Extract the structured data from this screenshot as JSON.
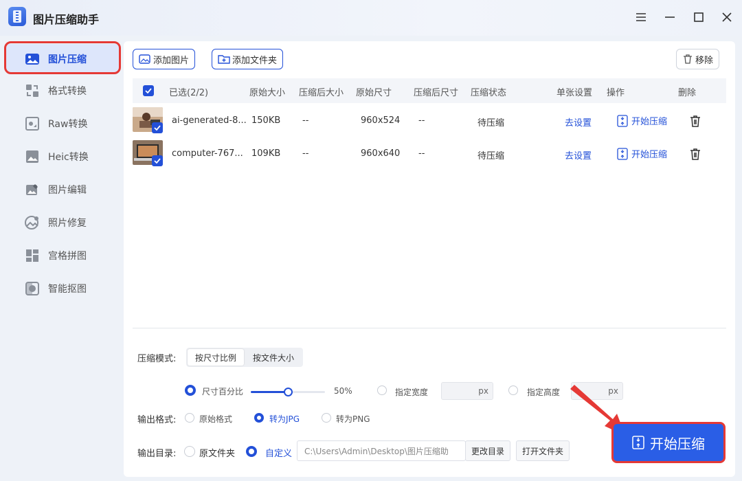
{
  "app": {
    "title": "图片压缩助手"
  },
  "sidebar": {
    "items": [
      {
        "label": "图片压缩",
        "icon": "image-compress-icon",
        "active": true
      },
      {
        "label": "格式转换",
        "icon": "format-convert-icon"
      },
      {
        "label": "Raw转换",
        "icon": "raw-convert-icon"
      },
      {
        "label": "Heic转换",
        "icon": "heic-convert-icon"
      },
      {
        "label": "图片编辑",
        "icon": "image-edit-icon"
      },
      {
        "label": "照片修复",
        "icon": "photo-repair-icon"
      },
      {
        "label": "宫格拼图",
        "icon": "grid-collage-icon"
      },
      {
        "label": "智能抠图",
        "icon": "smart-cutout-icon"
      }
    ]
  },
  "toolbar": {
    "add_image": "添加图片",
    "add_folder": "添加文件夹",
    "remove": "移除"
  },
  "table": {
    "headers": {
      "selected": "已选(2/2)",
      "orig_size": "原始大小",
      "compressed_size": "压缩后大小",
      "orig_dim": "原始尺寸",
      "compressed_dim": "压缩后尺寸",
      "status": "压缩状态",
      "single_setting": "单张设置",
      "action": "操作",
      "delete": "删除"
    },
    "rows": [
      {
        "name": "ai-generated-8...",
        "orig_size": "150KB",
        "compressed_size": "--",
        "orig_dim": "960x524",
        "compressed_dim": "--",
        "status": "待压缩",
        "setting": "去设置",
        "action": "开始压缩"
      },
      {
        "name": "computer-767...",
        "orig_size": "109KB",
        "compressed_size": "--",
        "orig_dim": "960x640",
        "compressed_dim": "--",
        "status": "待压缩",
        "setting": "去设置",
        "action": "开始压缩"
      }
    ]
  },
  "settings": {
    "mode_label": "压缩模式:",
    "mode_options": [
      "按尺寸比例",
      "按文件大小"
    ],
    "size_percent_label": "尺寸百分比",
    "size_percent_value": "50%",
    "size_percent_fraction": 0.5,
    "width_label": "指定宽度",
    "height_label": "指定高度",
    "px_unit": "px",
    "format_label": "输出格式:",
    "format_options": [
      "原始格式",
      "转为JPG",
      "转为PNG"
    ],
    "dir_label": "输出目录:",
    "dir_options": [
      "原文件夹",
      "自定义"
    ],
    "dir_path": "C:\\Users\\Admin\\Desktop\\图片压缩助",
    "change_dir": "更改目录",
    "open_folder": "打开文件夹"
  },
  "start_button": "开始压缩",
  "colors": {
    "accent": "#2350d8",
    "highlight": "#e53935"
  }
}
